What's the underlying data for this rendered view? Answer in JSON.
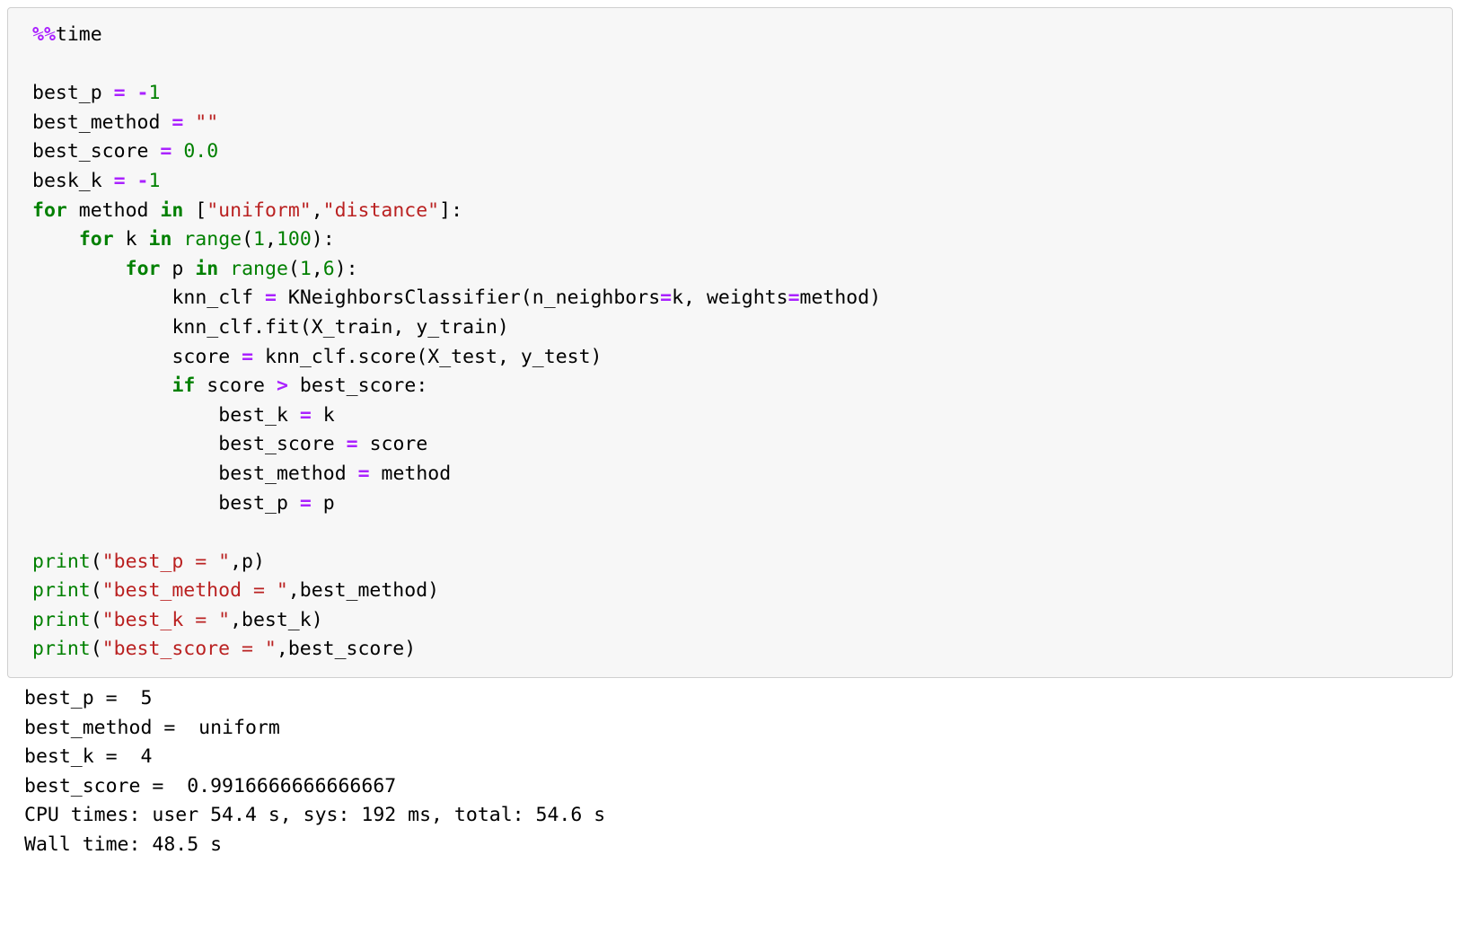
{
  "cell": {
    "kind": "code-cell",
    "magic": "%%time",
    "code_lines": [
      "%%time",
      "",
      "best_p = -1",
      "best_method = \"\"",
      "best_score = 0.0",
      "besk_k = -1",
      "for method in [\"uniform\",\"distance\"]:",
      "    for k in range(1,100):",
      "        for p in range(1,6):",
      "            knn_clf = KNeighborsClassifier(n_neighbors=k, weights=method)",
      "            knn_clf.fit(X_train, y_train)",
      "            score = knn_clf.score(X_test, y_test)",
      "            if score > best_score:",
      "                best_k = k",
      "                best_score = score",
      "                best_method = method",
      "                best_p = p",
      "",
      "print(\"best_p = \",p)",
      "print(\"best_method = \",best_method)",
      "print(\"best_k = \",best_k)",
      "print(\"best_score = \",best_score)"
    ]
  },
  "output": {
    "lines": [
      "best_p =  5",
      "best_method =  uniform",
      "best_k =  4",
      "best_score =  0.9916666666666667",
      "CPU times: user 54.4 s, sys: 192 ms, total: 54.6 s",
      "Wall time: 48.5 s"
    ],
    "results": {
      "best_p": "5",
      "best_method": "uniform",
      "best_k": "4",
      "best_score": "0.9916666666666667"
    },
    "timing": {
      "cpu_user": "54.4 s",
      "cpu_sys": "192 ms",
      "cpu_total": "54.6 s",
      "wall_time": "48.5 s"
    }
  },
  "colors": {
    "keyword": "#008000",
    "string": "#ba2121",
    "number": "#008000",
    "operator": "#aa22ff",
    "text": "#000000",
    "cell_background": "#f7f7f7",
    "cell_border": "#cfcfcf",
    "page_background": "#ffffff"
  }
}
